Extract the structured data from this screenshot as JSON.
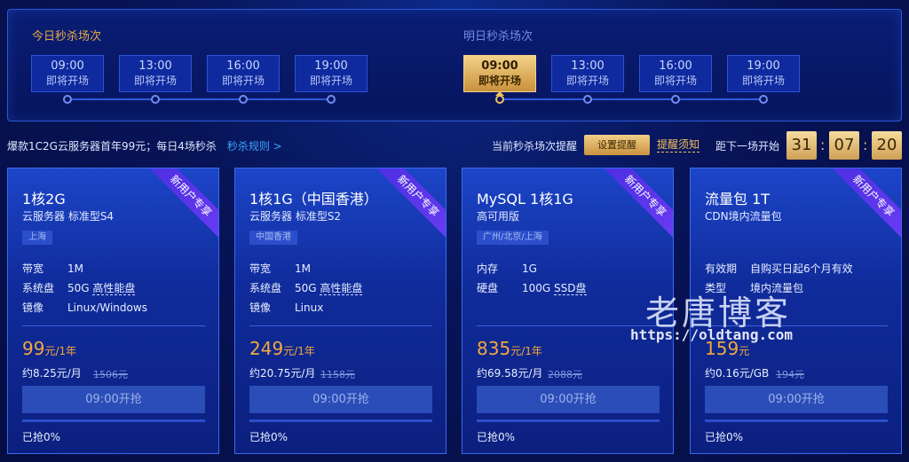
{
  "schedule": {
    "today_title": "今日秒杀场次",
    "tomorrow_title": "明日秒杀场次",
    "today_slots": [
      {
        "time": "09:00",
        "status": "即将开场"
      },
      {
        "time": "13:00",
        "status": "即将开场"
      },
      {
        "time": "16:00",
        "status": "即将开场"
      },
      {
        "time": "19:00",
        "status": "即将开场"
      }
    ],
    "tomorrow_slots": [
      {
        "time": "09:00",
        "status": "即将开场",
        "active": true
      },
      {
        "time": "13:00",
        "status": "即将开场"
      },
      {
        "time": "16:00",
        "status": "即将开场"
      },
      {
        "time": "19:00",
        "status": "即将开场"
      }
    ]
  },
  "info": {
    "promo_text": "爆款1C2G云服务器首年99元；每日4场秒杀",
    "rules_link": "秒杀规则 >",
    "reminder_label": "当前秒杀场次提醒",
    "set_reminder_button": "设置提醒",
    "reminder_notice": "提醒须知",
    "countdown_label": "距下一场开始",
    "countdown": {
      "hours": "31",
      "minutes": "07",
      "seconds": "20"
    },
    "colon": ":"
  },
  "cards": [
    {
      "ribbon": "新用户专享",
      "title": "1核2G",
      "subtitle": "云服务器 标准型S4",
      "region": "上海",
      "specs": [
        {
          "key": "带宽",
          "value": "1M",
          "underline": ""
        },
        {
          "key": "系统盘",
          "value": "50G ",
          "underline": "高性能盘"
        },
        {
          "key": "镜像",
          "value": "Linux/Windows",
          "underline": ""
        }
      ],
      "price": "99",
      "price_unit": "元/1年",
      "per_month": "约8.25元/月",
      "original_price": "1506元",
      "button": "09:00开抢",
      "progress": 0,
      "sold": "已抢0%"
    },
    {
      "ribbon": "新用户专享",
      "title": "1核1G（中国香港）",
      "subtitle": "云服务器 标准型S2",
      "region": "中国香港",
      "specs": [
        {
          "key": "带宽",
          "value": "1M",
          "underline": ""
        },
        {
          "key": "系统盘",
          "value": "50G ",
          "underline": "高性能盘"
        },
        {
          "key": "镜像",
          "value": "Linux",
          "underline": ""
        }
      ],
      "price": "249",
      "price_unit": "元/1年",
      "per_month": "约20.75元/月",
      "original_price": "1158元",
      "button": "09:00开抢",
      "progress": 0,
      "sold": "已抢0%"
    },
    {
      "ribbon": "新用户专享",
      "title": "MySQL 1核1G",
      "subtitle": "高可用版",
      "region": "广州/北京/上海",
      "specs": [
        {
          "key": "内存",
          "value": "1G",
          "underline": ""
        },
        {
          "key": "硬盘",
          "value": "100G ",
          "underline": "SSD盘"
        }
      ],
      "price": "835",
      "price_unit": "元/1年",
      "per_month": "约69.58元/月",
      "original_price": "2088元",
      "button": "09:00开抢",
      "progress": 0,
      "sold": "已抢0%"
    },
    {
      "ribbon": "新用户专享",
      "title": "流量包 1T",
      "subtitle": "CDN境内流量包",
      "region": "",
      "specs": [
        {
          "key": "有效期",
          "value": "自购买日起6个月有效",
          "underline": ""
        },
        {
          "key": "类型",
          "value": "境内流量包",
          "underline": ""
        }
      ],
      "price": "159",
      "price_unit": "元",
      "per_month": "约0.16元/GB",
      "original_price": "194元",
      "button": "09:00开抢",
      "progress": 0,
      "sold": "已抢0%"
    }
  ],
  "watermark": {
    "title": "老唐博客",
    "url": "https://oldtang.com"
  }
}
